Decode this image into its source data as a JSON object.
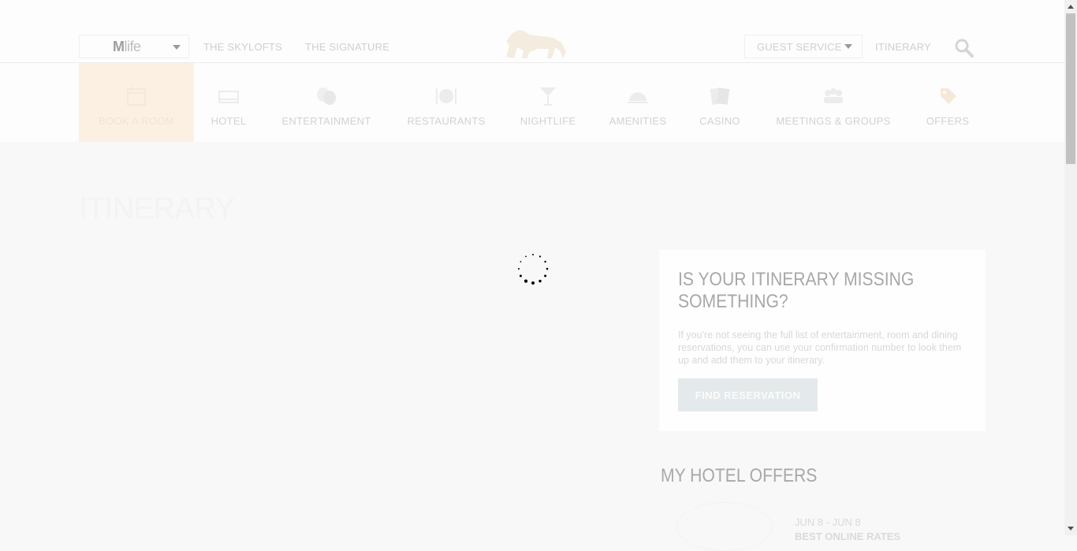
{
  "header": {
    "brand_select": {
      "logo_bold": "M",
      "logo_text": "life"
    },
    "links": [
      "THE SKYLOFTS",
      "THE SIGNATURE"
    ],
    "guest_service": "GUEST SERVICE",
    "itinerary": "ITINERARY"
  },
  "nav": {
    "items": [
      {
        "label": "BOOK A ROOM",
        "icon": "calendar-icon"
      },
      {
        "label": "HOTEL",
        "icon": "bed-icon"
      },
      {
        "label": "ENTERTAINMENT",
        "icon": "masks-icon"
      },
      {
        "label": "RESTAURANTS",
        "icon": "plate-icon"
      },
      {
        "label": "NIGHTLIFE",
        "icon": "cocktail-icon"
      },
      {
        "label": "AMENITIES",
        "icon": "service-bell-icon"
      },
      {
        "label": "CASINO",
        "icon": "cards-icon"
      },
      {
        "label": "MEETINGS & GROUPS",
        "icon": "people-icon"
      },
      {
        "label": "OFFERS",
        "icon": "tag-icon"
      }
    ],
    "active_index": 0
  },
  "main": {
    "title": "ITINERARY"
  },
  "sidebar": {
    "missing": {
      "heading": "IS YOUR ITINERARY MISSING SOMETHING?",
      "body": "If you're not seeing the full list of entertainment, room and dining reservations, you can use your confirmation number to look them up and add them to your itinerary.",
      "button": "FIND RESERVATION"
    },
    "offers": {
      "heading": "MY HOTEL OFFERS",
      "first_offer_dates": "JUN 8 - JUN 8",
      "first_offer_name": "BEST ONLINE RATES"
    }
  },
  "colors": {
    "accent_active_tab": "#fcf0e3",
    "button_bg": "#e4eaeb",
    "heading": "#a8a8a8"
  }
}
